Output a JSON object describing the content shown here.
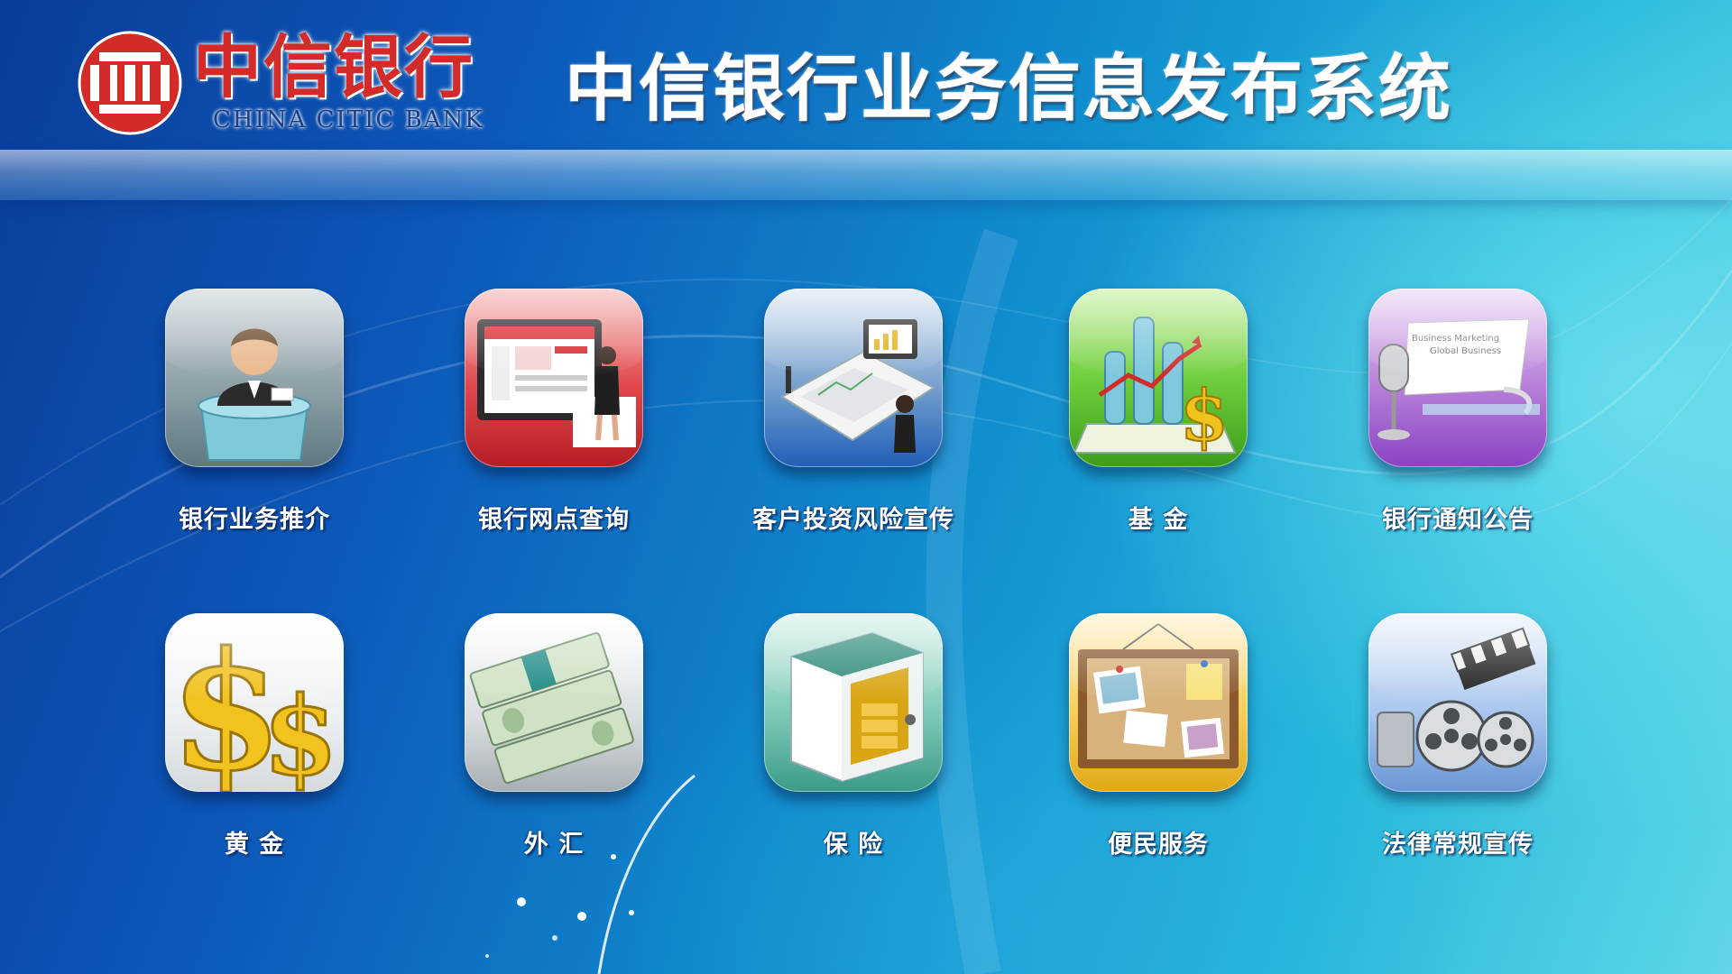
{
  "header": {
    "logo_cn": "中信银行",
    "logo_en": "CHINA CITIC BANK",
    "title": "中信银行业务信息发布系统"
  },
  "apps": [
    {
      "label": "银行业务推介",
      "icon": "bank-clerk-icon"
    },
    {
      "label": "银行网点查询",
      "icon": "branch-search-screen-icon"
    },
    {
      "label": "客户投资风险宣传",
      "icon": "investment-risk-documents-icon"
    },
    {
      "label": "基 金",
      "icon": "fund-chart-dollar-icon"
    },
    {
      "label": "银行通知公告",
      "icon": "microphone-announcement-icon"
    },
    {
      "label": "黄 金",
      "icon": "gold-dollar-signs-icon"
    },
    {
      "label": "外 汇",
      "icon": "cash-bundles-icon"
    },
    {
      "label": "保 险",
      "icon": "safe-box-icon"
    },
    {
      "label": "便民服务",
      "icon": "cork-bulletin-board-icon"
    },
    {
      "label": "法律常规宣传",
      "icon": "film-reels-clapperboard-icon"
    }
  ],
  "tile_promo_text": [
    "Business Marketing",
    "Global Business"
  ],
  "colors": {
    "brand_red": "#d32a2a",
    "background_deep": "#0a3d9a",
    "background_light": "#5fd6e6"
  }
}
